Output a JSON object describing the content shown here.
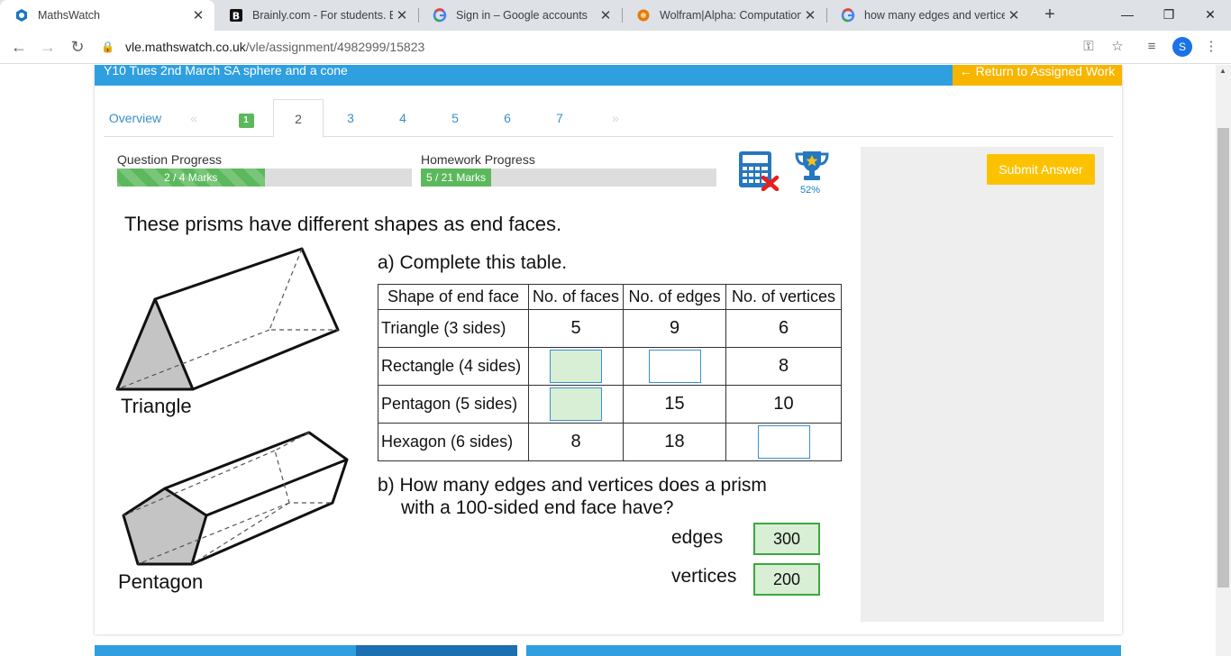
{
  "browser": {
    "tabs": [
      {
        "title": "MathsWatch",
        "icon": "mathswatch-icon",
        "active": true
      },
      {
        "title": "Brainly.com - For students. By students.",
        "icon": "brainly-icon",
        "active": false
      },
      {
        "title": "Sign in – Google accounts",
        "icon": "google-icon",
        "active": false
      },
      {
        "title": "Wolfram|Alpha: Computational Intelligence",
        "icon": "wolfram-icon",
        "active": false
      },
      {
        "title": "how many edges and vertices does a",
        "icon": "google-icon",
        "active": false
      }
    ],
    "close_glyph": "✕",
    "new_tab_glyph": "+",
    "url_host": "vle.mathswatch.co.uk",
    "url_path": "/vle/assignment/4982999/15823",
    "profile_initial": "S"
  },
  "assignment": {
    "title": "Y10 Tues 2nd March SA sphere and a cone",
    "return_label": "← Return to Assigned Work",
    "tabs": {
      "overview": "Overview",
      "prev": "«",
      "q1": "1",
      "q2": "2",
      "q3": "3",
      "q4": "4",
      "q5": "5",
      "q6": "6",
      "q7": "7",
      "next": "»"
    },
    "question_progress": {
      "label": "Question Progress",
      "text": "2 / 4 Marks",
      "fraction": 0.5
    },
    "homework_progress": {
      "label": "Homework Progress",
      "text": "5 / 21 Marks",
      "fraction": 0.238
    },
    "trophy_percent": "52%",
    "submit_label": "Submit Answer"
  },
  "question": {
    "intro": "These prisms have different shapes as end faces.",
    "part_a": "a) Complete this table.",
    "headers": [
      "Shape of end face",
      "No. of faces",
      "No. of edges",
      "No. of vertices"
    ],
    "rows": [
      {
        "shape": "Triangle (3 sides)",
        "faces": "5",
        "edges": "9",
        "vertices": "6"
      },
      {
        "shape": "Rectangle (4 sides)",
        "faces": "",
        "edges": "",
        "vertices": "8"
      },
      {
        "shape": "Pentagon (5 sides)",
        "faces": "",
        "edges": "15",
        "vertices": "10"
      },
      {
        "shape": "Hexagon (6 sides)",
        "faces": "8",
        "edges": "18",
        "vertices": ""
      }
    ],
    "triangle_label": "Triangle",
    "pentagon_label": "Pentagon",
    "part_b_line1": "b) How many edges and vertices does a prism",
    "part_b_line2": "with a 100-sided end face have?",
    "edges_label": "edges",
    "edges_value": "300",
    "vertices_label": "vertices",
    "vertices_value": "200"
  },
  "colors": {
    "header_blue": "#2f9fe0",
    "return_orange": "#f7b500",
    "progress_green": "#5cb85c",
    "submit_yellow": "#fcc200",
    "answer_fill": "#d8efd6"
  }
}
